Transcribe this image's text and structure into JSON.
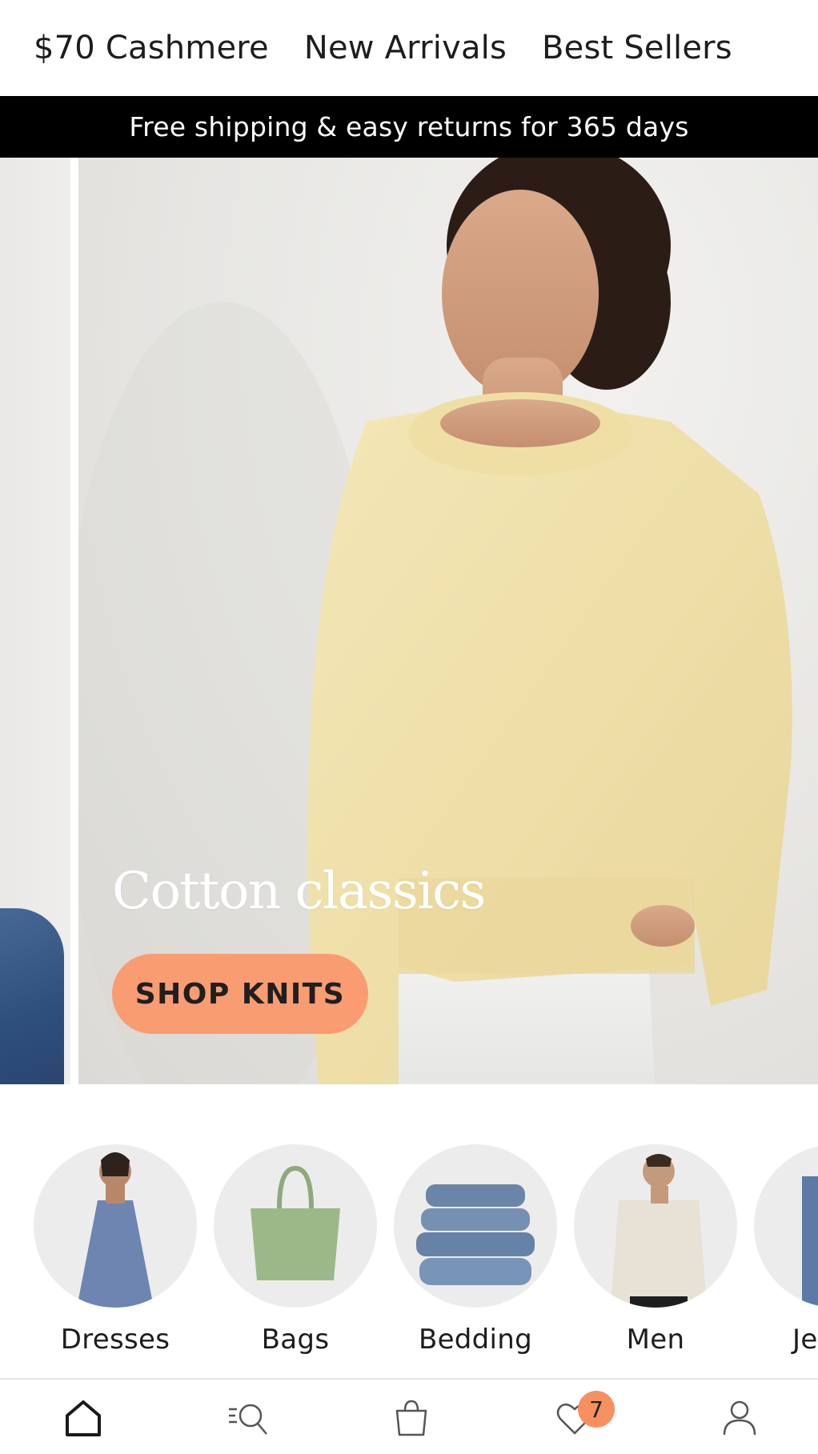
{
  "top_nav": {
    "items": [
      {
        "label": "$70 Cashmere"
      },
      {
        "label": "New Arrivals"
      },
      {
        "label": "Best Sellers"
      }
    ]
  },
  "promo": {
    "text": "Free shipping & easy returns for 365 days",
    "background": "#000000",
    "color": "#ffffff"
  },
  "hero": {
    "title": "Cotton classics",
    "cta_label": "SHOP KNITS",
    "cta_color": "#f99c72",
    "sweater_color": "#f1e3ac"
  },
  "categories": [
    {
      "label": "Dresses",
      "icon": "dress-photo"
    },
    {
      "label": "Bags",
      "icon": "tote-bag-photo"
    },
    {
      "label": "Bedding",
      "icon": "pillow-stack-photo"
    },
    {
      "label": "Men",
      "icon": "mens-shirt-photo"
    },
    {
      "label": "Je",
      "icon": "jeans-photo"
    }
  ],
  "tabbar": {
    "items": [
      {
        "name": "home",
        "icon": "home-icon",
        "active": true
      },
      {
        "name": "search",
        "icon": "search-icon"
      },
      {
        "name": "bag",
        "icon": "shopping-bag-icon"
      },
      {
        "name": "wishlist",
        "icon": "heart-icon"
      },
      {
        "name": "account",
        "icon": "user-icon"
      }
    ],
    "wishlist_badge": "7",
    "badge_color": "#f7905f"
  }
}
